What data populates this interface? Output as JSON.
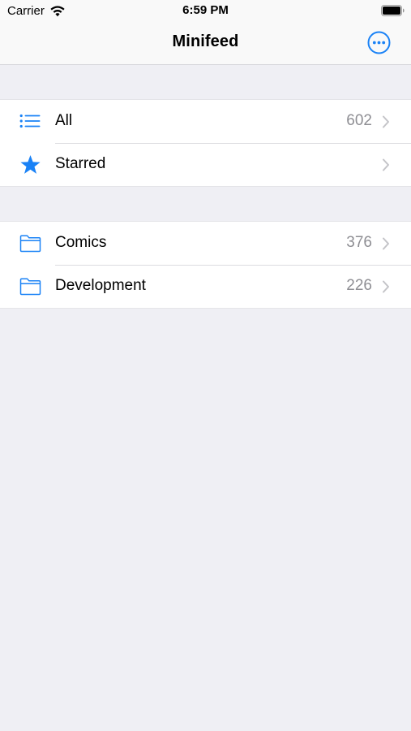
{
  "status_bar": {
    "carrier": "Carrier",
    "time": "6:59 PM",
    "wifi_icon": "wifi-icon",
    "battery_icon": "battery-icon"
  },
  "nav": {
    "title": "Minifeed",
    "more_icon": "ellipsis-circle-icon",
    "accent_color": "#1a82f6"
  },
  "groups": [
    {
      "rows": [
        {
          "icon": "list-icon",
          "label": "All",
          "count": "602"
        },
        {
          "icon": "star-icon",
          "label": "Starred",
          "count": ""
        }
      ]
    },
    {
      "rows": [
        {
          "icon": "folder-icon",
          "label": "Comics",
          "count": "376"
        },
        {
          "icon": "folder-icon",
          "label": "Development",
          "count": "226"
        }
      ]
    }
  ],
  "colors": {
    "background": "#efeff4",
    "row_background": "#ffffff",
    "secondary_text": "#8e8e93",
    "chevron": "#c4c4c8"
  }
}
